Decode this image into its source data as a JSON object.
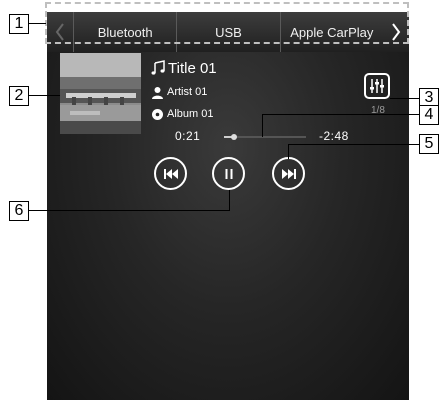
{
  "tabs": {
    "prev_label": "",
    "items": [
      {
        "label": "Bluetooth"
      },
      {
        "label": "USB"
      },
      {
        "label": "Apple CarPlay"
      }
    ],
    "next_label": ""
  },
  "track": {
    "title": "Title 01",
    "artist": "Artist 01",
    "album": "Album 01",
    "track_index": "1/8",
    "elapsed": "0:21",
    "remaining": "-2:48",
    "progress_fraction": 0.12
  },
  "icons": {
    "title": "music-note-icon",
    "artist": "person-icon",
    "album": "disc-icon",
    "eq": "equalizer-icon",
    "prev": "skip-back-icon",
    "pause": "pause-icon",
    "next": "skip-forward-icon"
  },
  "callouts": [
    "1",
    "2",
    "3",
    "4",
    "5",
    "6"
  ],
  "colors": {
    "screen_bg": "#262626",
    "foreground": "#ffffff",
    "callout_border": "#000000"
  }
}
